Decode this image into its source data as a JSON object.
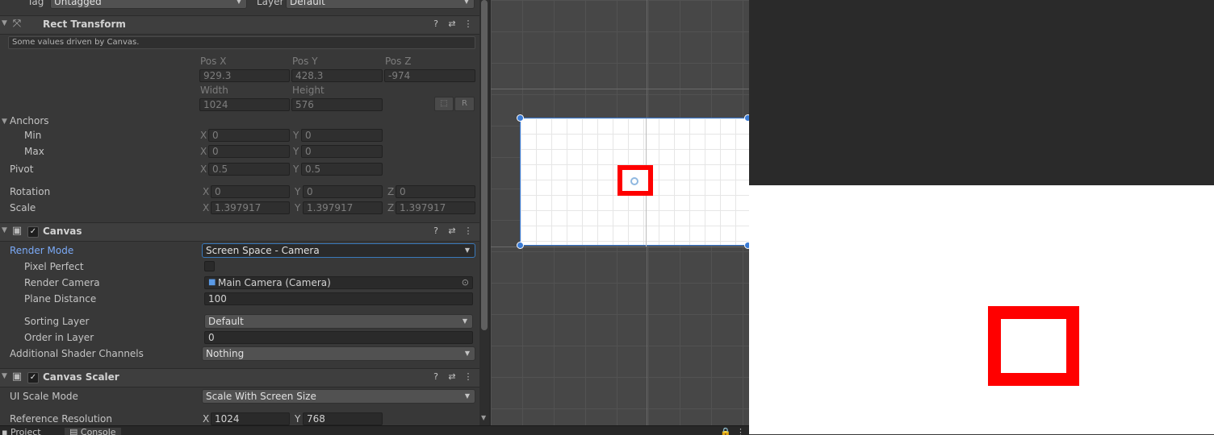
{
  "top_row": {
    "tag_label": "Tag",
    "tag_value": "Untagged",
    "layer_label": "Layer",
    "layer_value": "Default"
  },
  "rect_transform": {
    "title": "Rect Transform",
    "note": "Some values driven by Canvas.",
    "pos_x_label": "Pos X",
    "pos_y_label": "Pos Y",
    "pos_z_label": "Pos Z",
    "pos_x": "929.3",
    "pos_y": "428.3",
    "pos_z": "-974",
    "width_label": "Width",
    "height_label": "Height",
    "width": "1024",
    "height": "576",
    "r_button": "R",
    "anchors_label": "Anchors",
    "min_label": "Min",
    "max_label": "Max",
    "min_x": "0",
    "min_y": "0",
    "max_x": "0",
    "max_y": "0",
    "pivot_label": "Pivot",
    "pivot_x": "0.5",
    "pivot_y": "0.5",
    "rotation_label": "Rotation",
    "rot_x": "0",
    "rot_y": "0",
    "rot_z": "0",
    "scale_label": "Scale",
    "scale_x": "1.397917",
    "scale_y": "1.397917",
    "scale_z": "1.397917",
    "axis_x": "X",
    "axis_y": "Y",
    "axis_z": "Z"
  },
  "canvas": {
    "title": "Canvas",
    "render_mode_label": "Render Mode",
    "render_mode": "Screen Space - Camera",
    "pixel_perfect_label": "Pixel Perfect",
    "render_camera_label": "Render Camera",
    "render_camera": "Main Camera (Camera)",
    "plane_distance_label": "Plane Distance",
    "plane_distance": "100",
    "sorting_layer_label": "Sorting Layer",
    "sorting_layer": "Default",
    "order_in_layer_label": "Order in Layer",
    "order_in_layer": "0",
    "shader_channels_label": "Additional Shader Channels",
    "shader_channels": "Nothing"
  },
  "canvas_scaler": {
    "title": "Canvas Scaler",
    "scale_mode_label": "UI Scale Mode",
    "scale_mode": "Scale With Screen Size",
    "ref_res_label": "Reference Resolution",
    "ref_x": "1024",
    "ref_y": "768"
  },
  "bottom_tabs": {
    "project": "Project",
    "console": "Console"
  },
  "colors": {
    "accent": "#7baaf7",
    "selection_red": "#ff0000",
    "handle_blue": "#3a7bd5"
  }
}
